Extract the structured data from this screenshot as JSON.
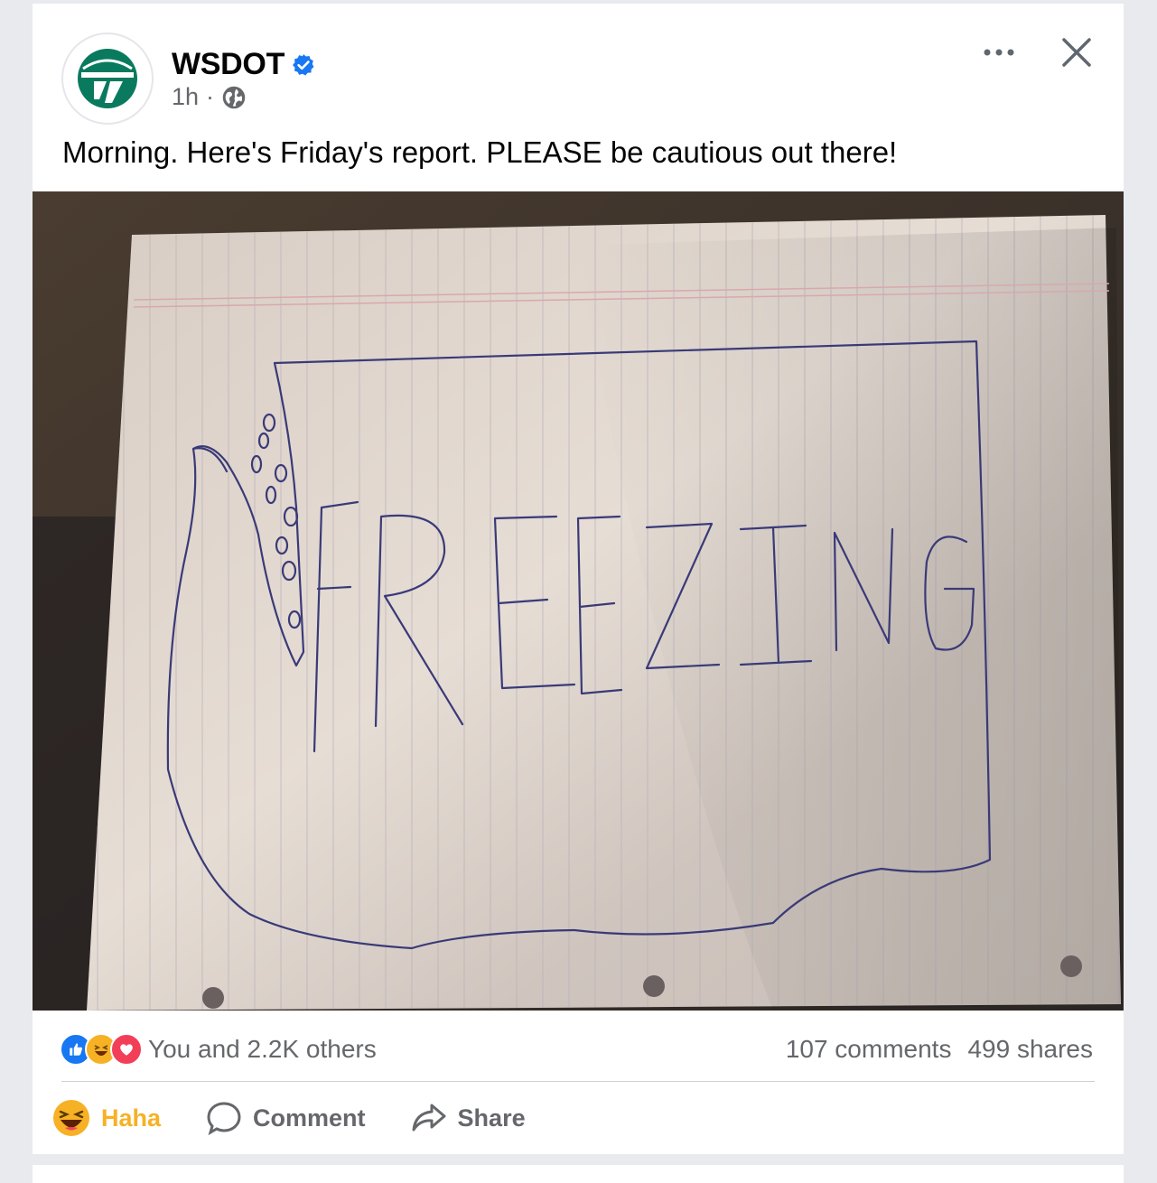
{
  "post": {
    "page_name": "WSDOT",
    "time": "1h",
    "separator": "·",
    "caption": "Morning. Here's Friday's report. PLEASE be cautious out there!"
  },
  "photo": {
    "drawn_text": "FREEZING"
  },
  "reactions": {
    "icons": [
      "like-icon",
      "haha-icon",
      "love-icon"
    ],
    "summary": "You and 2.2K others",
    "comments": "107 comments",
    "shares": "499 shares"
  },
  "actions": {
    "haha_label": "Haha",
    "comment_label": "Comment",
    "share_label": "Share"
  },
  "colors": {
    "brand_green": "#0a7a5e",
    "verified_blue": "#1877f2",
    "haha_yellow": "#f7b125",
    "love_red": "#f33e58",
    "secondary_text": "#65676b"
  }
}
